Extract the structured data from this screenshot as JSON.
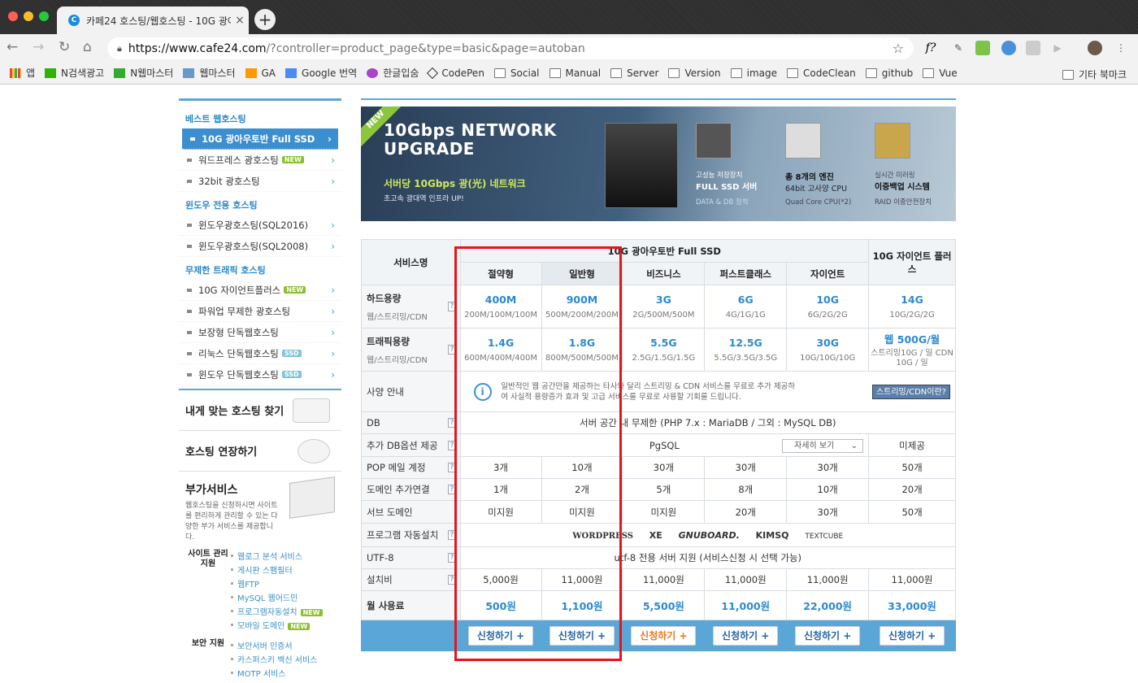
{
  "browser": {
    "tab_title": "카페24 호스팅/웹호스팅 - 10G 광아",
    "tab_icon_letter": "C",
    "url_host": "https://www.cafe24.com",
    "url_rest": "/?controller=product_page&type=basic&page=autoban",
    "ext_f": "f?",
    "bookmarks": [
      "앱",
      "N검색광고",
      "N웹마스터",
      "웹마스터",
      "GA",
      "Google 번역",
      "한글입숨",
      "CodePen",
      "Social",
      "Manual",
      "Server",
      "Version",
      "image",
      "CodeClean",
      "github",
      "Vue"
    ],
    "other_bookmarks": "기타 북마크"
  },
  "sidebar": {
    "cat1": "베스트 웹호스팅",
    "items1": [
      {
        "label": "10G 광아우토반 Full SSD"
      },
      {
        "label": "워드프레스 광호스팅"
      },
      {
        "label": "32bit 광호스팅"
      }
    ],
    "cat2": "윈도우 전용 호스팅",
    "items2": [
      {
        "label": "윈도우광호스팅(SQL2016)"
      },
      {
        "label": "윈도우광호스팅(SQL2008)"
      }
    ],
    "cat3": "무제한 트래픽 호스팅",
    "items3": [
      {
        "label": "10G 자이언트플러스"
      },
      {
        "label": "파워업 무제한 광호스팅"
      },
      {
        "label": "보장형 단독웹호스팅"
      },
      {
        "label": "리눅스 단독웹호스팅"
      },
      {
        "label": "윈도우 단독웹호스팅"
      }
    ],
    "badge_new": "NEW",
    "badge_ssd": "SSD",
    "tool1": "내게 맞는 호스팅 찾기",
    "tool2": "호스팅 연장하기",
    "addon_title": "부가서비스",
    "addon_desc": "웹호스팅을 신청하시면 사이트를 편리하게 관리할 수 있는 다양한 부가 서비스를 제공합니다.",
    "site_label": "사이트 관리 지원",
    "site_items": [
      "웹로그 분석 서비스",
      "게시판 스팸필터",
      "웹FTP",
      "MySQL 웹어드민",
      "프로그램자동설치",
      "모바일 도메인"
    ],
    "sec_label": "보안 지원",
    "sec_items": [
      "보안서버 인증서",
      "카스퍼스키 백신 서비스",
      "MOTP 서비스"
    ]
  },
  "banner": {
    "new": "NEW",
    "headline1": "10Gbps NETWORK",
    "headline2": "UPGRADE",
    "sub1": "서버당 10Gbps 광(光) 네트워크",
    "sub2": "초고속 광대역 인프라 UP!",
    "features": [
      {
        "line1": "고성능 저장장치",
        "line2": "FULL SSD 서버",
        "line3": "DATA & DB 장착"
      },
      {
        "line1": "총 8개의 엔진",
        "line2": "64bit 고사양 CPU",
        "line3": "Quad Core CPU(*2)"
      },
      {
        "line1": "실시간 미러링",
        "line2": "이중백업 시스템",
        "line3": "RAID 이중안전장치"
      }
    ]
  },
  "table": {
    "service_name": "서비스명",
    "group_header": "10G 광아우토반 Full SSD",
    "giant_plus": "10G 자이언트 플러스",
    "plans": [
      "절약형",
      "일반형",
      "비즈니스",
      "퍼스트클래스",
      "자이언트"
    ],
    "hdd_label": "하드용량",
    "hdd_sub": "웹/스트리밍/CDN",
    "hdd": [
      {
        "v": "400M",
        "s": "200M/100M/100M"
      },
      {
        "v": "900M",
        "s": "500M/200M/200M"
      },
      {
        "v": "3G",
        "s": "2G/500M/500M"
      },
      {
        "v": "6G",
        "s": "4G/1G/1G"
      },
      {
        "v": "10G",
        "s": "6G/2G/2G"
      },
      {
        "v": "14G",
        "s": "10G/2G/2G"
      }
    ],
    "traffic_label": "트래픽용량",
    "traffic_sub": "웹/스트리밍/CDN",
    "traffic": [
      {
        "v": "1.4G",
        "s": "600M/400M/400M"
      },
      {
        "v": "1.8G",
        "s": "800M/500M/500M"
      },
      {
        "v": "5.5G",
        "s": "2.5G/1.5G/1.5G"
      },
      {
        "v": "12.5G",
        "s": "5.5G/3.5G/3.5G"
      },
      {
        "v": "30G",
        "s": "10G/10G/10G"
      },
      {
        "v": "웹 500G/월",
        "s": "스트리밍10G / 일 CDN 10G / 일"
      }
    ],
    "spec_label": "사양 안내",
    "spec_text": "일반적인 웹 공간만을 제공하는 타사와 달리 스트리밍 & CDN 서비스를 무료로 추가 제공하여 사실적 용량증가 효과 및 고급 서비스를 무료로 사용할 기회를 드립니다.",
    "cdn_button": "스트리밍/CDN이란?",
    "db_label": "DB",
    "db_text": "서버 공간 내 무제한 (PHP 7.x : MariaDB / 그외 : MySQL DB)",
    "dbopt_label": "추가 DB옵션 제공",
    "dbopt_text": "PgSQL",
    "dbopt_detail": "자세히 보기",
    "dbopt_giant": "미제공",
    "pop_label": "POP 메일 계정",
    "pop": [
      "3개",
      "10개",
      "30개",
      "30개",
      "30개",
      "50개"
    ],
    "domain_label": "도메인 추가연결",
    "domain": [
      "1개",
      "2개",
      "5개",
      "8개",
      "10개",
      "20개"
    ],
    "subdomain_label": "서브 도메인",
    "subdomain": [
      "미지원",
      "미지원",
      "미지원",
      "20개",
      "30개",
      "50개"
    ],
    "autoinstall_label": "프로그램 자동설치",
    "programs": [
      "WORDPRESS",
      "XE",
      "GNUBOARD.",
      "KIMSQ",
      "TEXTCUBE"
    ],
    "utf8_label": "UTF-8",
    "utf8_text": "utf-8 전용 서버 지원 (서비스신청 시 선택 가능)",
    "setup_label": "설치비",
    "setup": [
      "5,000원",
      "11,000원",
      "11,000원",
      "11,000원",
      "11,000원",
      "11,000원"
    ],
    "monthly_label": "월 사용료",
    "monthly": [
      "500원",
      "1,100원",
      "5,500원",
      "11,000원",
      "22,000원",
      "33,000원"
    ],
    "apply": "신청하기"
  },
  "colors": {
    "accent": "#2b8ad0",
    "highlight_box": "#e8141c"
  }
}
